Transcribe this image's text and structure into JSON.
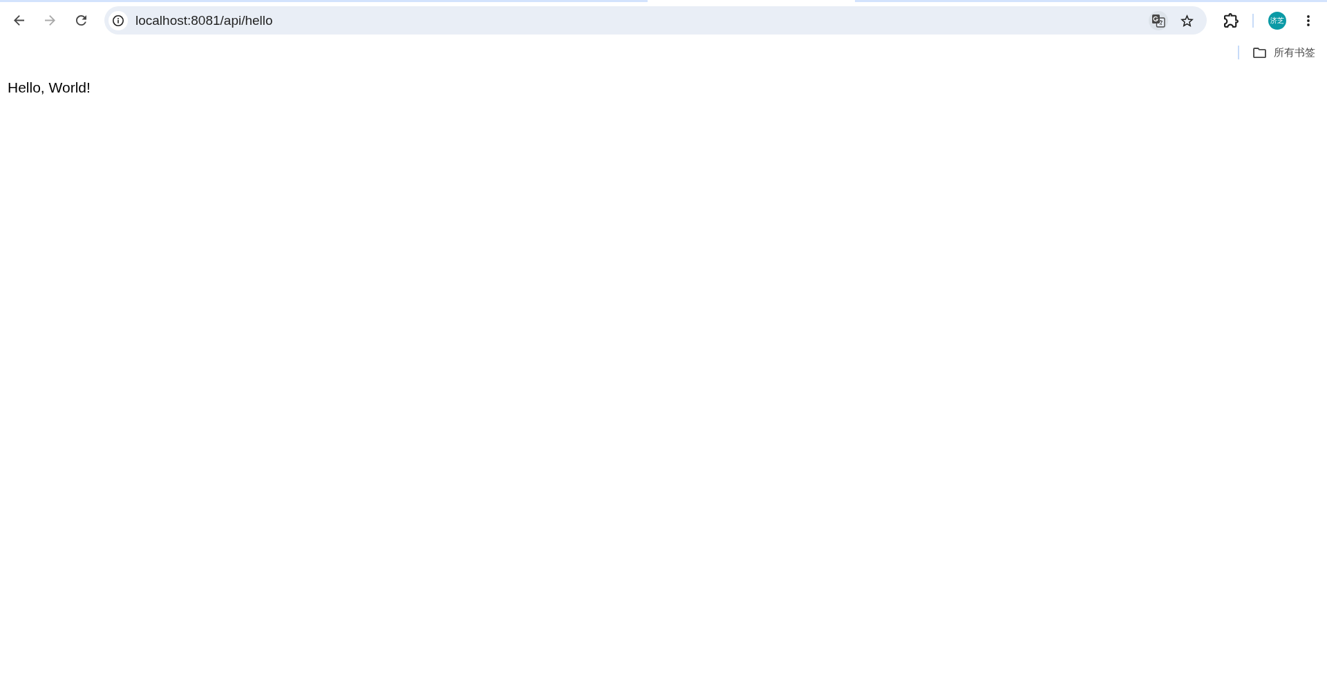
{
  "toolbar": {
    "nav_buttons": [
      {
        "kind": "back",
        "disabled": false
      },
      {
        "kind": "forward",
        "disabled": true
      },
      {
        "kind": "reload",
        "disabled": false
      }
    ],
    "address_bar": {
      "url": "localhost:8081/api/hello"
    },
    "profile": {
      "initials": "济芝"
    }
  },
  "bookmarks_bar": {
    "items": [
      {
        "kind": "folder",
        "label": "所有书签"
      }
    ]
  },
  "page": {
    "text": "Hello, World!"
  }
}
